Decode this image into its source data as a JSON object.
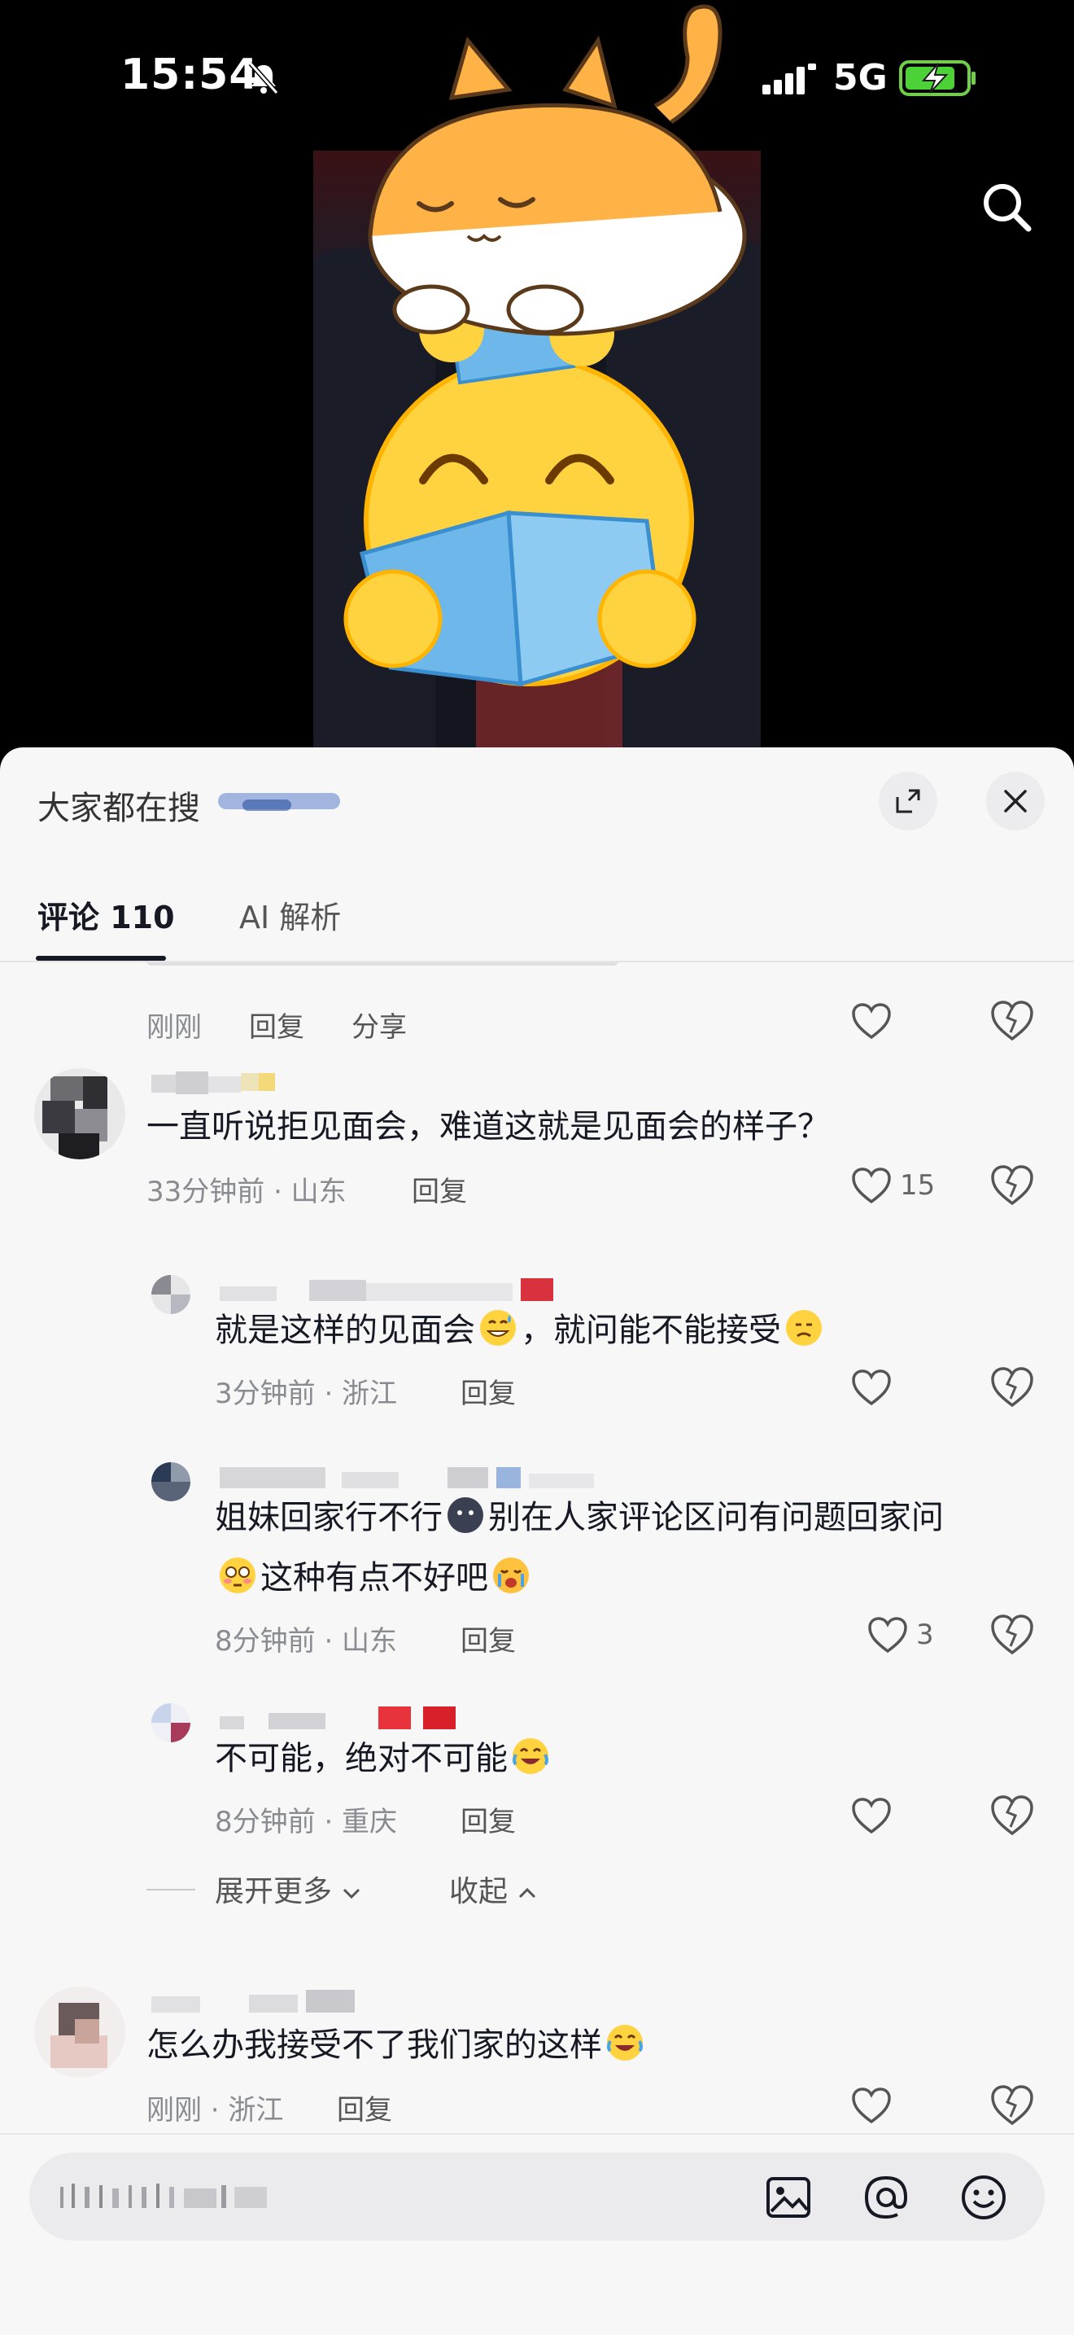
{
  "status_bar": {
    "time": "15:54",
    "network": "5G"
  },
  "sheet": {
    "title": "大家都在搜",
    "tabs": [
      {
        "label": "评论 110"
      },
      {
        "label": "AI 解析"
      }
    ]
  },
  "comments": [
    {
      "text": "",
      "time": "刚刚",
      "reply_label": "回复",
      "share_label": "分享"
    },
    {
      "text": "一直听说拒见面会，难道这就是见面会的样子？",
      "time": "33分钟前 · 山东",
      "reply_label": "回复",
      "likes": "15"
    },
    {
      "text_before": "就是这样的见面会",
      "text_after": "，就问能不能接受",
      "time": "3分钟前 · 浙江",
      "reply_label": "回复",
      "emoji": [
        "grin-sweat-emoji",
        "frown-emoji"
      ]
    },
    {
      "line1_before": "姐妹回家行不行",
      "line1_after": "别在人家评论区问有问题回家问",
      "line2": "这种有点不好吧",
      "time": "8分钟前 · 山东",
      "reply_label": "回复",
      "likes": "3",
      "emoji": [
        "dark-blob-emoji",
        "flushed-emoji",
        "sob-emoji"
      ]
    },
    {
      "text": "不可能，绝对不可能",
      "time": "8分钟前 · 重庆",
      "reply_label": "回复",
      "emoji": [
        "laugh-cry-emoji"
      ]
    },
    {
      "text": "怎么办我接受不了我们家的这样",
      "time": "刚刚 · 浙江",
      "reply_label": "回复",
      "emoji": [
        "laugh-cry-emoji"
      ]
    }
  ],
  "thread": {
    "expand_more": "展开更多",
    "collapse": "收起"
  },
  "input": {
    "placeholder": ""
  },
  "colors": {
    "sheet_bg": "#f7f7f8",
    "text": "#161823",
    "meta": "#8a8b91",
    "emoji_yellow": "#ffd23f"
  }
}
